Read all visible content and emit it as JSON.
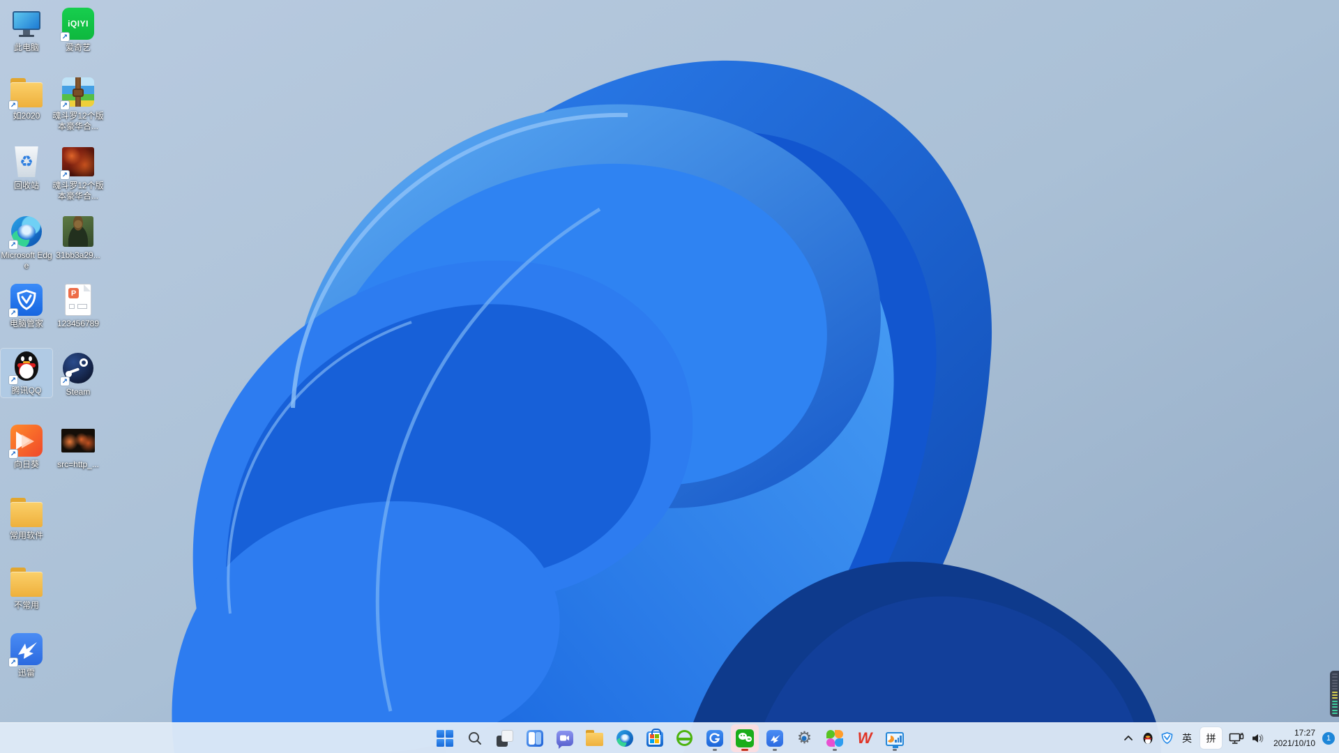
{
  "desktop": {
    "icons": [
      {
        "kind": "this-pc",
        "label": "此电脑",
        "shortcut": false,
        "selected": false
      },
      {
        "kind": "iqiyi",
        "label": "爱奇艺",
        "shortcut": true,
        "selected": false
      },
      {
        "kind": "folder",
        "label": "如2020",
        "shortcut": true,
        "selected": false
      },
      {
        "kind": "rar-archive",
        "label": "魂斗罗12个版本豪华合...",
        "shortcut": true,
        "selected": false
      },
      {
        "kind": "recycle-bin",
        "label": "回收站",
        "shortcut": false,
        "selected": false
      },
      {
        "kind": "game-image",
        "label": "魂斗罗12个版本豪华合...",
        "shortcut": true,
        "selected": false
      },
      {
        "kind": "microsoft-edge",
        "label": "Microsoft Edge",
        "shortcut": true,
        "selected": false
      },
      {
        "kind": "photo-image",
        "label": "31bb3a29...",
        "shortcut": false,
        "selected": false
      },
      {
        "kind": "pc-manager",
        "label": "电脑管家",
        "shortcut": true,
        "selected": false
      },
      {
        "kind": "ppt-file",
        "label": "123456789",
        "shortcut": false,
        "selected": false
      },
      {
        "kind": "tencent-qq",
        "label": "腾讯QQ",
        "shortcut": true,
        "selected": true
      },
      {
        "kind": "steam",
        "label": "Steam",
        "shortcut": true,
        "selected": false
      },
      {
        "kind": "sunflower-remote",
        "label": "向日葵",
        "shortcut": true,
        "selected": false
      },
      {
        "kind": "src-image",
        "label": "src=http_...",
        "shortcut": false,
        "selected": false
      },
      {
        "kind": "folder",
        "label": "常用软件",
        "shortcut": false,
        "selected": false
      },
      {
        "kind": "folder",
        "label": "不常用",
        "shortcut": false,
        "selected": false
      },
      {
        "kind": "thunder-xunlei",
        "label": "迅雷",
        "shortcut": true,
        "selected": false
      }
    ]
  },
  "taskbar": {
    "buttons": [
      {
        "icon": "windows-start",
        "indicator": "none",
        "active": false
      },
      {
        "icon": "search",
        "indicator": "none",
        "active": false
      },
      {
        "icon": "task-view",
        "indicator": "none",
        "active": false
      },
      {
        "icon": "widgets",
        "indicator": "none",
        "active": false
      },
      {
        "icon": "chat-teams",
        "indicator": "none",
        "active": false
      },
      {
        "icon": "file-explorer",
        "indicator": "none",
        "active": false
      },
      {
        "icon": "microsoft-edge",
        "indicator": "none",
        "active": false
      },
      {
        "icon": "microsoft-store",
        "indicator": "none",
        "active": false
      },
      {
        "icon": "360-browser",
        "indicator": "none",
        "active": false
      },
      {
        "icon": "360-safeguard",
        "indicator": "gray",
        "active": false
      },
      {
        "icon": "wechat",
        "indicator": "red",
        "active": true
      },
      {
        "icon": "thunder-xunlei",
        "indicator": "gray",
        "active": false
      },
      {
        "icon": "settings",
        "indicator": "none",
        "active": false
      },
      {
        "icon": "app-clover",
        "indicator": "gray",
        "active": false
      },
      {
        "icon": "wps-office",
        "indicator": "none",
        "active": false
      },
      {
        "icon": "hardware-monitor",
        "indicator": "gray",
        "active": false
      }
    ],
    "tray": {
      "ime_en": "英",
      "ime_pinyin": "拼",
      "icons": [
        "chevron-up",
        "qq",
        "pc-manager-shield",
        "network",
        "volume"
      ]
    },
    "clock": {
      "time": "17:27",
      "date": "2021/10/10"
    },
    "notification_badge": "1"
  },
  "colors": {
    "taskbar_bg": "#dee9f6",
    "wechat_green": "#1aad19",
    "active_button_bg": "#f9dee2",
    "indicator_red": "#c4311c",
    "badge_blue": "#1d86d8",
    "selection_highlight": "rgba(175,205,235,0.55)",
    "wallpaper_blue_bright": "#2f83f2",
    "wallpaper_blue_deep": "#0e3a8c"
  }
}
